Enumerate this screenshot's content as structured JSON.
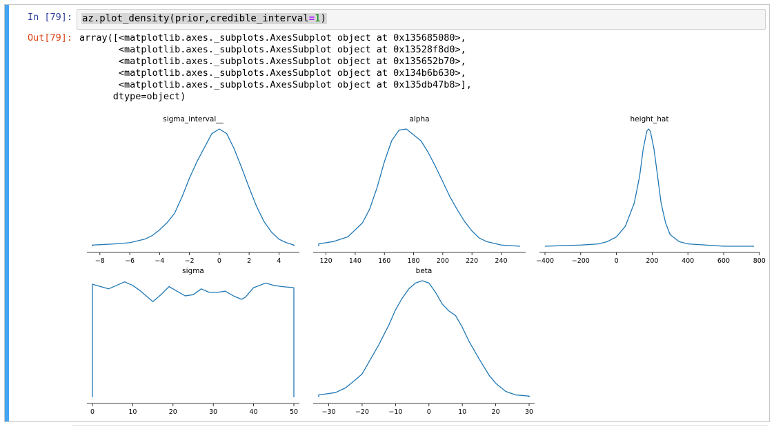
{
  "cell": {
    "in_prompt": "In [79]:",
    "out_prompt": "Out[79]:",
    "code_parts": [
      "az.plot_density(prior,credible_interval",
      "=",
      "1",
      ")"
    ],
    "output_lines": [
      "array([<matplotlib.axes._subplots.AxesSubplot object at 0x135685080>,",
      "       <matplotlib.axes._subplots.AxesSubplot object at 0x13528f8d0>,",
      "       <matplotlib.axes._subplots.AxesSubplot object at 0x135652b70>,",
      "       <matplotlib.axes._subplots.AxesSubplot object at 0x134b6b630>,",
      "       <matplotlib.axes._subplots.AxesSubplot object at 0x135db47b8>],",
      "      dtype=object)"
    ]
  },
  "colors": {
    "line": "#1f77b4",
    "cell_bar": "#42a5f5",
    "in_prompt": "#303f9f",
    "out_prompt": "#d84315"
  },
  "chart_data": [
    {
      "type": "line",
      "title": "sigma_interval__",
      "xticks": [
        -8,
        -6,
        -4,
        -2,
        0,
        2,
        4
      ],
      "xlim": [
        -8.5,
        5
      ],
      "x": [
        -8.5,
        -7,
        -6,
        -5,
        -4.5,
        -4,
        -3.5,
        -3,
        -2.5,
        -2,
        -1.5,
        -1,
        -0.5,
        0,
        0.5,
        1,
        1.5,
        2,
        2.5,
        3,
        3.5,
        4,
        4.5,
        5
      ],
      "y": [
        0.01,
        0.02,
        0.03,
        0.06,
        0.09,
        0.14,
        0.2,
        0.28,
        0.42,
        0.58,
        0.72,
        0.84,
        0.96,
        1.0,
        0.96,
        0.83,
        0.67,
        0.5,
        0.34,
        0.21,
        0.12,
        0.06,
        0.03,
        0.01
      ]
    },
    {
      "type": "line",
      "title": "alpha",
      "xticks": [
        120,
        140,
        160,
        180,
        200,
        220,
        240
      ],
      "xlim": [
        115,
        253
      ],
      "x": [
        115,
        125,
        135,
        145,
        150,
        155,
        160,
        165,
        170,
        175,
        180,
        185,
        190,
        195,
        200,
        205,
        210,
        215,
        220,
        225,
        230,
        240,
        253
      ],
      "y": [
        0.02,
        0.04,
        0.08,
        0.2,
        0.32,
        0.5,
        0.72,
        0.9,
        0.99,
        1.0,
        0.95,
        0.9,
        0.8,
        0.68,
        0.55,
        0.42,
        0.31,
        0.21,
        0.13,
        0.07,
        0.04,
        0.01,
        0.0
      ]
    },
    {
      "type": "line",
      "title": "height_hat",
      "xticks": [
        -400,
        -200,
        0,
        200,
        400,
        600,
        800
      ],
      "xlim": [
        -400,
        770
      ],
      "x": [
        -400,
        -200,
        -100,
        -50,
        0,
        50,
        100,
        130,
        150,
        170,
        180,
        190,
        210,
        230,
        250,
        275,
        300,
        350,
        400,
        500,
        600,
        770
      ],
      "y": [
        0.0,
        0.01,
        0.02,
        0.04,
        0.08,
        0.17,
        0.37,
        0.6,
        0.83,
        0.98,
        1.0,
        0.98,
        0.83,
        0.6,
        0.37,
        0.2,
        0.1,
        0.04,
        0.02,
        0.01,
        0.0,
        0.0
      ]
    },
    {
      "type": "line",
      "title": "sigma",
      "xticks": [
        0,
        10,
        20,
        30,
        40,
        50
      ],
      "xlim": [
        0,
        50
      ],
      "x": [
        0,
        2,
        4,
        6,
        8,
        10,
        12,
        15,
        17,
        19,
        21,
        23,
        25,
        27,
        29,
        31,
        33,
        35,
        37,
        38,
        40,
        43,
        45,
        47,
        50
      ],
      "y": [
        0.97,
        0.95,
        0.93,
        0.96,
        0.99,
        0.96,
        0.91,
        0.82,
        0.88,
        0.95,
        0.91,
        0.87,
        0.88,
        0.93,
        0.9,
        0.9,
        0.91,
        0.87,
        0.84,
        0.86,
        0.94,
        0.98,
        0.96,
        0.95,
        0.94
      ]
    },
    {
      "type": "line",
      "title": "beta",
      "xticks": [
        -30,
        -20,
        -10,
        0,
        10,
        20,
        30
      ],
      "xlim": [
        -33,
        30
      ],
      "x": [
        -33,
        -28,
        -25,
        -22,
        -20,
        -18,
        -15,
        -12,
        -10,
        -8,
        -6,
        -4,
        -2,
        0,
        2,
        4,
        6,
        8,
        10,
        12,
        15,
        18,
        20,
        23,
        26,
        30
      ],
      "y": [
        0.02,
        0.04,
        0.08,
        0.15,
        0.2,
        0.3,
        0.45,
        0.62,
        0.75,
        0.85,
        0.93,
        0.98,
        1.0,
        0.98,
        0.9,
        0.8,
        0.74,
        0.7,
        0.6,
        0.48,
        0.33,
        0.19,
        0.12,
        0.05,
        0.02,
        0.01
      ]
    }
  ]
}
